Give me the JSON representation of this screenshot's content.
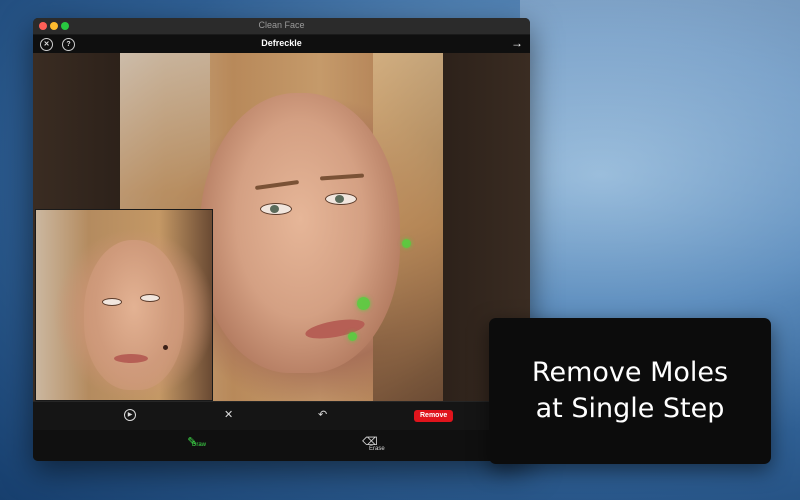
{
  "window": {
    "title": "Clean Face"
  },
  "toolbar": {
    "title": "Defreckle",
    "close_icon": "close-circle-icon",
    "help_icon": "help-circle-icon",
    "next_icon": "arrow-right-icon"
  },
  "actions": {
    "play_icon": "play-circle-icon",
    "cancel_icon": "close-x-icon",
    "undo_icon": "undo-icon",
    "remove_label": "Remove",
    "remove_color": "#e0141c"
  },
  "modes": {
    "draw_label": "Draw",
    "erase_label": "Erase",
    "active_color": "#3fe04a"
  },
  "caption": {
    "line1": "Remove Moles",
    "line2": "at Single Step"
  }
}
